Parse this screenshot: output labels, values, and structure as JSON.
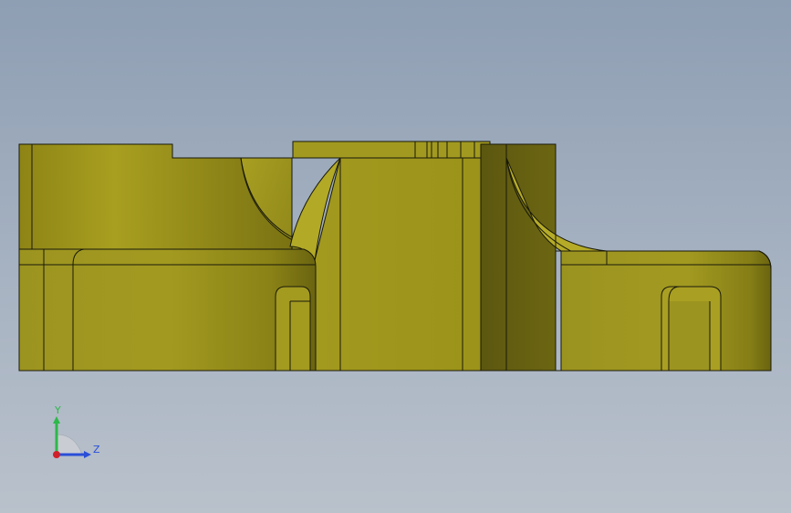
{
  "viewport": {
    "background_top": "#8e9eb3",
    "background_bottom": "#b9c1cb"
  },
  "model": {
    "face_color": "#a39a1f",
    "shade_color": "#6e6710",
    "edge_color": "#1a1a0a",
    "view": "front"
  },
  "triad": {
    "y_label": "Y",
    "z_label": "Z",
    "y_color": "#2db84a",
    "z_color": "#2a4ed8",
    "x_color": "#d0202a"
  }
}
